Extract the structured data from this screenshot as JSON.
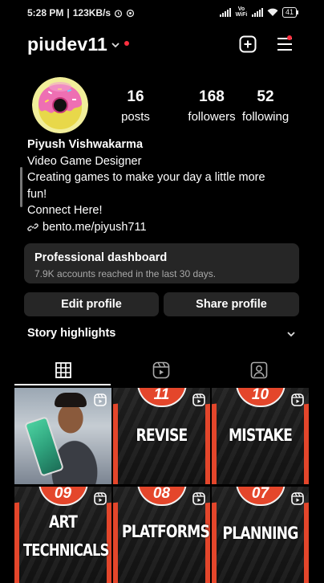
{
  "status_bar": {
    "time": "5:28 PM",
    "speed": "123KB/s",
    "network": "Vo WiFi",
    "battery": "41"
  },
  "header": {
    "username": "piudev11",
    "new_post_icon": "plus-square-icon",
    "menu_icon": "hamburger-menu-icon"
  },
  "profile": {
    "stats": {
      "posts_count": "16",
      "posts_label": "posts",
      "followers_count": "168",
      "followers_label": "followers",
      "following_count": "52",
      "following_label": "following"
    },
    "name": "Piyush Vishwakarma",
    "category": "Video Game Designer",
    "bio_line1": "Creating games to make your day a little more",
    "bio_line2": "fun!",
    "bio_line3": "Connect Here!",
    "link": "bento.me/piyush711"
  },
  "dashboard": {
    "title": "Professional dashboard",
    "subtitle": "7.9K accounts reached in the last 30 days."
  },
  "buttons": {
    "edit": "Edit profile",
    "share": "Share profile"
  },
  "highlights": {
    "label": "Story highlights"
  },
  "tabs": [
    "posts-grid-icon",
    "reels-icon",
    "tagged-icon"
  ],
  "posts": [
    {
      "type": "photo"
    },
    {
      "number": "11",
      "title": "REVISE"
    },
    {
      "number": "10",
      "title": "MISTAKE"
    },
    {
      "number": "09",
      "title_line1": "ART",
      "title_line2": "TECHNICALS"
    },
    {
      "number": "08",
      "title": "PLATFORMS"
    },
    {
      "number": "07",
      "title": "PLANNING"
    }
  ],
  "colors": {
    "background": "#000000",
    "surface": "#262626",
    "accent_red": "#ff3040",
    "thumbnail_orange": "#e4462b"
  }
}
